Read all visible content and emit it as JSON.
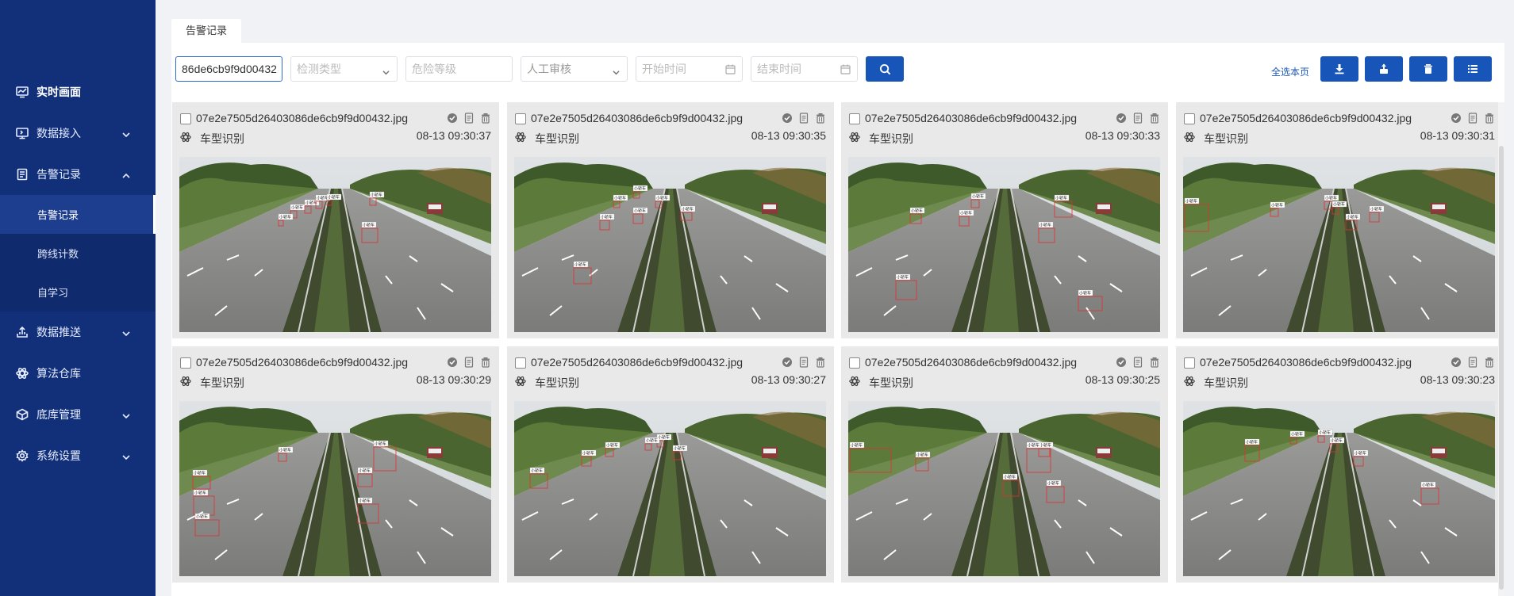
{
  "sidebar": {
    "items": [
      {
        "label": "实时画面",
        "icon": "monitor-chart-icon",
        "active": true
      },
      {
        "label": "数据接入",
        "icon": "computer-icon",
        "expandable": true
      },
      {
        "label": "告警记录",
        "icon": "document-icon",
        "expanded": true
      },
      {
        "label": "数据推送",
        "icon": "upload-icon",
        "expandable": true
      },
      {
        "label": "算法仓库",
        "icon": "atom-icon"
      },
      {
        "label": "底库管理",
        "icon": "cube-icon",
        "expandable": true
      },
      {
        "label": "系统设置",
        "icon": "gear-icon",
        "expandable": true
      }
    ],
    "subitems": [
      {
        "label": "告警记录",
        "active": true
      },
      {
        "label": "跨线计数"
      },
      {
        "label": "自学习"
      }
    ]
  },
  "tab": {
    "label": "告警记录"
  },
  "filters": {
    "search_value": "86de6cb9f9d00432",
    "detect_type_placeholder": "检测类型",
    "danger_level_placeholder": "危险等级",
    "review_placeholder": "人工审核",
    "start_time_placeholder": "开始时间",
    "end_time_placeholder": "结束时间"
  },
  "toolbar": {
    "select_all_label": "全选本页"
  },
  "colors": {
    "sidebar_bg": "#12307a",
    "accent": "#1855b8",
    "detection_box": "#e03030"
  },
  "cards": [
    {
      "filename": "07e2e7505d26403086de6cb9f9d00432.jpg",
      "type": "车型识别",
      "time": "08-13 09:30:37",
      "box_label": "小轿车"
    },
    {
      "filename": "07e2e7505d26403086de6cb9f9d00432.jpg",
      "type": "车型识别",
      "time": "08-13 09:30:35",
      "box_label": "小轿车"
    },
    {
      "filename": "07e2e7505d26403086de6cb9f9d00432.jpg",
      "type": "车型识别",
      "time": "08-13 09:30:33",
      "box_label": "小轿车"
    },
    {
      "filename": "07e2e7505d26403086de6cb9f9d00432.jpg",
      "type": "车型识别",
      "time": "08-13 09:30:31",
      "box_label": "小轿车"
    },
    {
      "filename": "07e2e7505d26403086de6cb9f9d00432.jpg",
      "type": "车型识别",
      "time": "08-13 09:30:29",
      "box_label": "小轿车"
    },
    {
      "filename": "07e2e7505d26403086de6cb9f9d00432.jpg",
      "type": "车型识别",
      "time": "08-13 09:30:27",
      "box_label": "小轿车"
    },
    {
      "filename": "07e2e7505d26403086de6cb9f9d00432.jpg",
      "type": "车型识别",
      "time": "08-13 09:30:25",
      "box_label": "小轿车"
    },
    {
      "filename": "07e2e7505d26403086de6cb9f9d00432.jpg",
      "type": "车型识别",
      "time": "08-13 09:30:23",
      "box_label": "小轿车"
    }
  ]
}
